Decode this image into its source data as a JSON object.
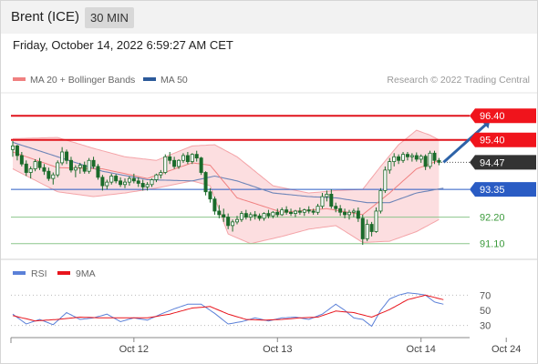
{
  "header": {
    "title": "Brent (ICE)",
    "timeframe": "30 MIN"
  },
  "datetime": "Friday, October 14, 2022 6:59:27 AM CET",
  "legend": [
    {
      "label": "MA 20 + Bollinger Bands",
      "color": "#f08080"
    },
    {
      "label": "MA 50",
      "color": "#2c5a9a"
    }
  ],
  "copyright": "Research © 2022 Trading Central",
  "rsi_legend": [
    {
      "label": "RSI",
      "color": "#5b80d8"
    },
    {
      "label": "9MA",
      "color": "#e8141c"
    }
  ],
  "chart_data": {
    "type": "candlestick",
    "instrument": "Brent (ICE)",
    "interval": "30 MIN",
    "ylim": [
      90.6,
      97.2
    ],
    "n_bars": 96,
    "last_price": 94.47,
    "levels": [
      {
        "value": 96.4,
        "label": "96.40",
        "style": "resistance",
        "color": "#e0141c"
      },
      {
        "value": 95.4,
        "label": "95.40",
        "style": "resistance",
        "color": "#e0141c"
      },
      {
        "value": 94.47,
        "label": "94.47",
        "style": "current",
        "color": "#333333"
      },
      {
        "value": 93.35,
        "label": "93.35",
        "style": "pivot",
        "color": "#2a5cc4"
      },
      {
        "value": 92.2,
        "label": "92.20",
        "style": "support",
        "color": "#3b9a3b"
      },
      {
        "value": 91.1,
        "label": "91.10",
        "style": "support",
        "color": "#3b9a3b"
      }
    ],
    "x_ticks": [
      {
        "label": "Oct 12",
        "index": 27
      },
      {
        "label": "Oct 13",
        "index": 59
      },
      {
        "label": "Oct 14",
        "index": 91
      },
      {
        "label": "Oct 24",
        "index": 110
      }
    ],
    "candles": [
      [
        95.0,
        95.35,
        94.7,
        95.15
      ],
      [
        95.15,
        95.2,
        94.55,
        94.75
      ],
      [
        94.75,
        94.9,
        94.3,
        94.4
      ],
      [
        94.4,
        94.55,
        93.9,
        94.05
      ],
      [
        94.05,
        94.3,
        93.8,
        94.2
      ],
      [
        94.2,
        94.6,
        94.1,
        94.5
      ],
      [
        94.5,
        94.65,
        94.15,
        94.25
      ],
      [
        94.25,
        94.4,
        93.95,
        94.1
      ],
      [
        94.1,
        94.25,
        93.7,
        93.8
      ],
      [
        93.8,
        94.05,
        93.55,
        93.95
      ],
      [
        93.95,
        94.55,
        93.85,
        94.45
      ],
      [
        94.45,
        95.1,
        94.35,
        94.9
      ],
      [
        94.9,
        95.0,
        94.4,
        94.55
      ],
      [
        94.55,
        94.7,
        94.05,
        94.15
      ],
      [
        94.15,
        94.35,
        93.85,
        94.25
      ],
      [
        94.25,
        94.45,
        94.0,
        94.35
      ],
      [
        94.35,
        94.5,
        94.0,
        94.1
      ],
      [
        94.1,
        94.65,
        94.0,
        94.55
      ],
      [
        94.55,
        94.7,
        94.2,
        94.3
      ],
      [
        94.3,
        94.4,
        93.75,
        93.85
      ],
      [
        93.85,
        93.95,
        93.3,
        93.5
      ],
      [
        93.5,
        93.75,
        93.35,
        93.65
      ],
      [
        93.65,
        94.0,
        93.55,
        93.9
      ],
      [
        93.9,
        93.98,
        93.6,
        93.7
      ],
      [
        93.7,
        93.85,
        93.45,
        93.55
      ],
      [
        93.55,
        93.8,
        93.4,
        93.65
      ],
      [
        93.65,
        93.9,
        93.5,
        93.8
      ],
      [
        93.8,
        94.0,
        93.6,
        93.7
      ],
      [
        93.7,
        93.85,
        93.45,
        93.6
      ],
      [
        93.6,
        93.75,
        93.3,
        93.45
      ],
      [
        93.45,
        93.65,
        93.3,
        93.55
      ],
      [
        93.55,
        93.8,
        93.45,
        93.75
      ],
      [
        93.75,
        94.0,
        93.65,
        93.95
      ],
      [
        93.95,
        94.15,
        93.8,
        94.05
      ],
      [
        94.05,
        94.8,
        93.98,
        94.7
      ],
      [
        94.7,
        94.9,
        94.4,
        94.55
      ],
      [
        94.55,
        94.7,
        94.2,
        94.3
      ],
      [
        94.3,
        94.6,
        94.2,
        94.55
      ],
      [
        94.55,
        94.85,
        94.45,
        94.75
      ],
      [
        94.75,
        94.9,
        94.4,
        94.5
      ],
      [
        94.5,
        94.85,
        94.4,
        94.8
      ],
      [
        94.8,
        94.95,
        94.5,
        94.65
      ],
      [
        94.65,
        94.7,
        93.95,
        94.05
      ],
      [
        94.05,
        94.1,
        93.1,
        93.25
      ],
      [
        93.25,
        93.4,
        92.8,
        92.95
      ],
      [
        92.95,
        93.05,
        92.3,
        92.45
      ],
      [
        92.45,
        92.7,
        92.15,
        92.3
      ],
      [
        92.3,
        92.55,
        92.0,
        92.2
      ],
      [
        92.2,
        92.35,
        91.7,
        91.85
      ],
      [
        91.85,
        92.1,
        91.6,
        92.0
      ],
      [
        92.0,
        92.25,
        91.9,
        92.1
      ],
      [
        92.1,
        92.45,
        92.0,
        92.35
      ],
      [
        92.35,
        92.5,
        92.1,
        92.2
      ],
      [
        92.2,
        92.4,
        92.05,
        92.3
      ],
      [
        92.3,
        92.45,
        92.1,
        92.25
      ],
      [
        92.25,
        92.35,
        92.05,
        92.15
      ],
      [
        92.15,
        92.4,
        92.05,
        92.35
      ],
      [
        92.35,
        92.5,
        92.15,
        92.25
      ],
      [
        92.25,
        92.45,
        92.15,
        92.4
      ],
      [
        92.4,
        92.55,
        92.2,
        92.3
      ],
      [
        92.3,
        92.6,
        92.25,
        92.5
      ],
      [
        92.5,
        92.65,
        92.3,
        92.4
      ],
      [
        92.4,
        92.55,
        92.25,
        92.35
      ],
      [
        92.35,
        92.5,
        92.2,
        92.45
      ],
      [
        92.45,
        92.6,
        92.3,
        92.4
      ],
      [
        92.4,
        92.55,
        92.25,
        92.5
      ],
      [
        92.5,
        92.65,
        92.35,
        92.45
      ],
      [
        92.45,
        92.55,
        92.3,
        92.4
      ],
      [
        92.4,
        92.75,
        92.3,
        92.65
      ],
      [
        92.65,
        93.2,
        92.55,
        93.05
      ],
      [
        93.05,
        93.3,
        92.85,
        93.15
      ],
      [
        93.15,
        93.35,
        92.55,
        92.65
      ],
      [
        92.65,
        92.8,
        92.4,
        92.55
      ],
      [
        92.55,
        92.7,
        92.25,
        92.4
      ],
      [
        92.4,
        92.55,
        92.15,
        92.3
      ],
      [
        92.3,
        92.5,
        92.1,
        92.4
      ],
      [
        92.4,
        92.55,
        92.2,
        92.45
      ],
      [
        92.45,
        92.6,
        92.0,
        92.15
      ],
      [
        92.15,
        92.3,
        91.05,
        91.3
      ],
      [
        91.3,
        92.1,
        91.2,
        91.9
      ],
      [
        91.9,
        92.0,
        91.4,
        91.6
      ],
      [
        91.6,
        92.6,
        91.55,
        92.45
      ],
      [
        92.45,
        93.4,
        92.35,
        93.3
      ],
      [
        93.3,
        94.3,
        93.2,
        94.15
      ],
      [
        94.15,
        94.65,
        94.0,
        94.5
      ],
      [
        94.5,
        94.85,
        94.3,
        94.7
      ],
      [
        94.7,
        94.8,
        94.4,
        94.55
      ],
      [
        94.55,
        94.9,
        94.45,
        94.8
      ],
      [
        94.8,
        94.9,
        94.55,
        94.7
      ],
      [
        94.7,
        94.85,
        94.5,
        94.75
      ],
      [
        94.75,
        94.88,
        94.5,
        94.6
      ],
      [
        94.6,
        94.8,
        94.45,
        94.72
      ],
      [
        94.72,
        94.8,
        94.15,
        94.3
      ],
      [
        94.3,
        94.95,
        94.2,
        94.85
      ],
      [
        94.85,
        94.95,
        94.4,
        94.55
      ],
      [
        94.55,
        94.65,
        94.35,
        94.47
      ]
    ],
    "ma20": [
      [
        0,
        94.9
      ],
      [
        10,
        94.25
      ],
      [
        20,
        94.2
      ],
      [
        30,
        93.8
      ],
      [
        40,
        94.45
      ],
      [
        44,
        94.35
      ],
      [
        50,
        93.0
      ],
      [
        60,
        92.4
      ],
      [
        70,
        92.55
      ],
      [
        78,
        92.3
      ],
      [
        84,
        93.2
      ],
      [
        90,
        94.2
      ],
      [
        95,
        94.55
      ]
    ],
    "bollinger_upper": [
      [
        0,
        95.45
      ],
      [
        10,
        95.5
      ],
      [
        18,
        95.05
      ],
      [
        25,
        94.7
      ],
      [
        32,
        94.55
      ],
      [
        40,
        95.15
      ],
      [
        45,
        95.2
      ],
      [
        50,
        94.7
      ],
      [
        58,
        93.5
      ],
      [
        66,
        93.2
      ],
      [
        72,
        93.3
      ],
      [
        78,
        93.35
      ],
      [
        82,
        94.3
      ],
      [
        86,
        95.2
      ],
      [
        90,
        95.8
      ],
      [
        93,
        95.6
      ],
      [
        95,
        95.4
      ]
    ],
    "bollinger_lower": [
      [
        0,
        94.2
      ],
      [
        10,
        93.25
      ],
      [
        18,
        93.05
      ],
      [
        25,
        93.2
      ],
      [
        32,
        93.4
      ],
      [
        40,
        93.7
      ],
      [
        44,
        93.5
      ],
      [
        48,
        91.5
      ],
      [
        53,
        91.1
      ],
      [
        60,
        91.4
      ],
      [
        66,
        91.7
      ],
      [
        72,
        91.85
      ],
      [
        78,
        91.15
      ],
      [
        84,
        91.2
      ],
      [
        90,
        91.6
      ],
      [
        95,
        92.1
      ]
    ],
    "ma50": [
      [
        0,
        95.3
      ],
      [
        10,
        94.7
      ],
      [
        20,
        94.1
      ],
      [
        30,
        93.75
      ],
      [
        40,
        93.7
      ],
      [
        45,
        93.9
      ],
      [
        50,
        93.7
      ],
      [
        58,
        93.2
      ],
      [
        66,
        93.05
      ],
      [
        72,
        93.0
      ],
      [
        79,
        92.8
      ],
      [
        84,
        92.8
      ],
      [
        90,
        93.2
      ],
      [
        96,
        93.4
      ]
    ],
    "projection": {
      "from_index": 95,
      "from_value": 94.47,
      "to_index": 106,
      "to_value": 96.4
    },
    "rsi": {
      "ylim": [
        20,
        80
      ],
      "ticks": [
        70,
        50,
        30
      ],
      "guide_levels": [
        70,
        30
      ],
      "rsi_values": [
        [
          0,
          45
        ],
        [
          3,
          32
        ],
        [
          6,
          38
        ],
        [
          9,
          31
        ],
        [
          12,
          47
        ],
        [
          15,
          38
        ],
        [
          18,
          40
        ],
        [
          21,
          45
        ],
        [
          24,
          35
        ],
        [
          27,
          40
        ],
        [
          30,
          37
        ],
        [
          33,
          45
        ],
        [
          36,
          52
        ],
        [
          39,
          58
        ],
        [
          42,
          58
        ],
        [
          45,
          46
        ],
        [
          48,
          32
        ],
        [
          51,
          35
        ],
        [
          54,
          40
        ],
        [
          57,
          36
        ],
        [
          60,
          40
        ],
        [
          63,
          41
        ],
        [
          66,
          38
        ],
        [
          69,
          45
        ],
        [
          72,
          58
        ],
        [
          74,
          50
        ],
        [
          76,
          40
        ],
        [
          78,
          38
        ],
        [
          80,
          29
        ],
        [
          82,
          50
        ],
        [
          84,
          65
        ],
        [
          86,
          70
        ],
        [
          88,
          73
        ],
        [
          90,
          72
        ],
        [
          92,
          70
        ],
        [
          94,
          61
        ],
        [
          96,
          58
        ]
      ],
      "ma_values": [
        [
          0,
          43
        ],
        [
          5,
          36
        ],
        [
          10,
          38
        ],
        [
          15,
          41
        ],
        [
          20,
          40
        ],
        [
          25,
          40
        ],
        [
          30,
          40
        ],
        [
          35,
          45
        ],
        [
          40,
          53
        ],
        [
          44,
          55
        ],
        [
          48,
          45
        ],
        [
          52,
          38
        ],
        [
          56,
          37
        ],
        [
          60,
          38
        ],
        [
          64,
          40
        ],
        [
          68,
          41
        ],
        [
          72,
          49
        ],
        [
          76,
          47
        ],
        [
          80,
          41
        ],
        [
          84,
          51
        ],
        [
          88,
          64
        ],
        [
          92,
          70
        ],
        [
          96,
          64
        ]
      ]
    }
  }
}
